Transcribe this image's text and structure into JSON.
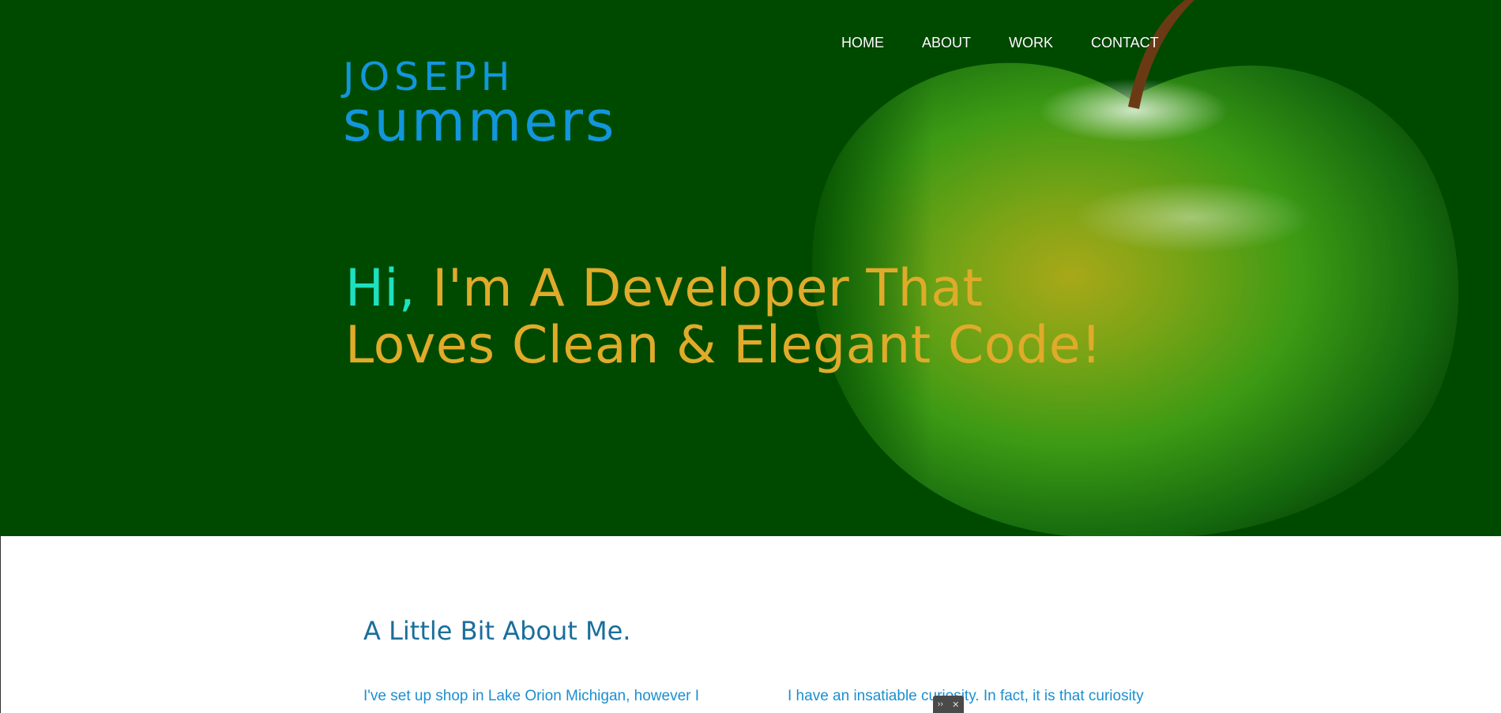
{
  "logo": {
    "first_name": "joseph",
    "last_name": "summers"
  },
  "nav": {
    "items": [
      {
        "label": "HOME"
      },
      {
        "label": "ABOUT"
      },
      {
        "label": "WORK"
      },
      {
        "label": "CONTACT"
      }
    ]
  },
  "hero": {
    "greeting": "Hi,",
    "line1_rest": " I'm A Developer That",
    "line2": "Loves Clean & Elegant Code!"
  },
  "about": {
    "title": "A Little Bit About Me.",
    "col1": "I've set up shop in Lake Orion Michigan, however I",
    "col2": "I have an insatiable curiosity. In fact, it is that curiosity"
  },
  "toolbar": {
    "expand": "››",
    "close": "✕"
  },
  "colors": {
    "hero_bg": "#004a00",
    "logo": "#1296dc",
    "headline": "#e0ab2a",
    "greeting": "#1ee0c0",
    "about_title": "#1a6e9c",
    "about_text": "#1b8fd0"
  }
}
